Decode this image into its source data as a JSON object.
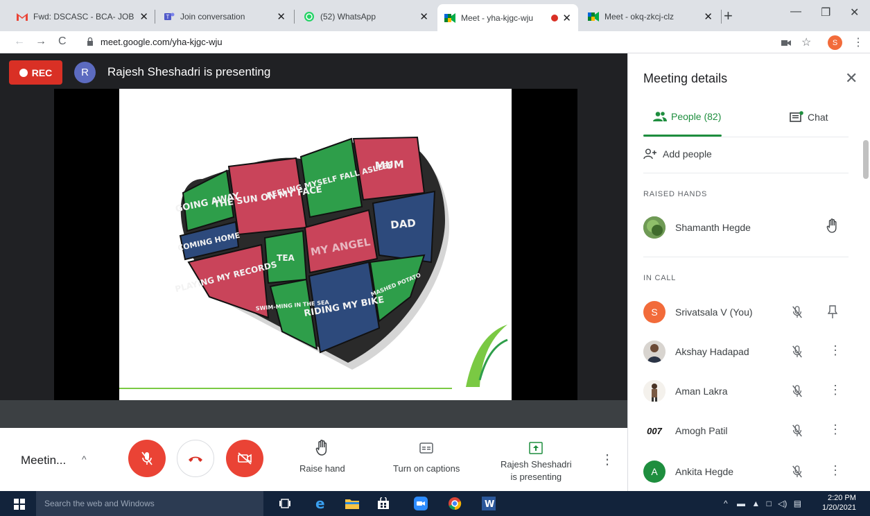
{
  "browser": {
    "tabs": [
      {
        "title": "Fwd: DSCASC - BCA- JOB F",
        "icon": "gmail-icon"
      },
      {
        "title": "Join conversation",
        "icon": "teams-icon"
      },
      {
        "title": "(52) WhatsApp",
        "icon": "whatsapp-icon"
      },
      {
        "title": "Meet - yha-kjgc-wju",
        "icon": "meet-icon"
      },
      {
        "title": "Meet - okq-zkcj-clz",
        "icon": "meet-icon"
      }
    ],
    "url": "meet.google.com/yha-kjgc-wju",
    "profile_initial": "S"
  },
  "meet": {
    "rec_label": "REC",
    "presenter_initial": "R",
    "presenting_text": "Rajesh Sheshadri is presenting",
    "meeting_short_title": "Meetin...",
    "raise_hand": "Raise hand",
    "captions": "Turn on captions",
    "presenting_button_line1": "Rajesh Sheshadri",
    "presenting_button_line2": "is presenting",
    "slide": {
      "blocks": [
        "GOING AWAY",
        "THE SUN ON MY FACE",
        "FEELING MYSELF FALL ASLEEP",
        "MUM",
        "COMING HOME",
        "DAD",
        "TEA",
        "MY ANGEL",
        "PLAYING MY RECORDS",
        "SWIM-MING IN THE SEA",
        "RIDING MY BIKE",
        "MASHED POTATO"
      ]
    }
  },
  "panel": {
    "title": "Meeting details",
    "tab_people": "People (82)",
    "tab_chat": "Chat",
    "add_people": "Add people",
    "raised_hands_header": "RAISED HANDS",
    "raised_hands": [
      {
        "name": "Shamanth Hegde"
      }
    ],
    "in_call_header": "IN CALL",
    "in_call": [
      {
        "name": "Srivatsala V (You)",
        "initial": "S",
        "color": "#f26b3a"
      },
      {
        "name": "Akshay Hadapad",
        "initial": "",
        "color": "#6d6d6d"
      },
      {
        "name": "Aman Lakra",
        "initial": "",
        "color": "#c8b89a"
      },
      {
        "name": "Amogh Patil",
        "initial": "007",
        "color": "#ffffff"
      },
      {
        "name": "Ankita Hegde",
        "initial": "A",
        "color": "#1e8e3e"
      }
    ]
  },
  "taskbar": {
    "search_placeholder": "Search the web and Windows",
    "time": "2:20 PM",
    "date": "1/20/2021"
  }
}
